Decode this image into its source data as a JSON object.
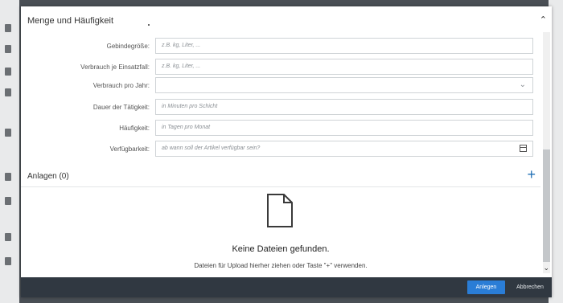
{
  "section": {
    "title": "Menge und Häufigkeit",
    "collapse_icon": "chevron-up-icon"
  },
  "form": {
    "fields": [
      {
        "label": "Gebindegröße:",
        "placeholder": "z.B. kg, Liter, ...",
        "type": "text"
      },
      {
        "label": "Verbrauch je Einsatzfall:",
        "placeholder": "z.B. kg, Liter, ...",
        "type": "text"
      },
      {
        "label": "Verbrauch pro Jahr:",
        "placeholder": "",
        "type": "select"
      },
      {
        "label": "Dauer der Tätigkeit:",
        "placeholder": "in Minuten pro Schicht",
        "type": "text"
      },
      {
        "label": "Häufigkeit:",
        "placeholder": "in Tagen pro Monat",
        "type": "text"
      },
      {
        "label": "Verfügbarkeit:",
        "placeholder": "ab wann soll der Artikel verfügbar sein?",
        "type": "date"
      }
    ]
  },
  "attachments": {
    "title": "Anlagen (0)",
    "add_icon": "plus-icon",
    "empty_title": "Keine Dateien gefunden.",
    "empty_hint": "Dateien für Upload hierher ziehen oder Taste \"+\" verwenden."
  },
  "footer": {
    "create_label": "Anlegen",
    "cancel_label": "Abbrechen"
  },
  "colors": {
    "accent": "#2a7dd6",
    "footer_bg": "#303841",
    "plus": "#1f6fb5"
  }
}
